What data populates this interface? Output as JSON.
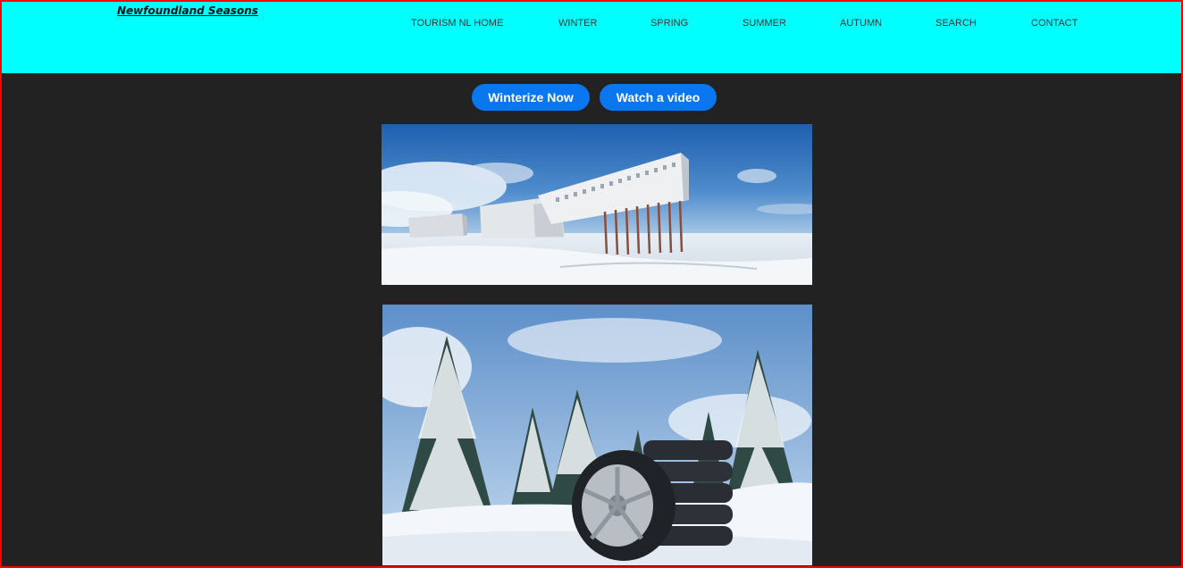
{
  "header": {
    "site_title": "Newfoundland Seasons",
    "nav": [
      "TOURISM NL HOME",
      "WINTER",
      "SPRING",
      "SUMMER",
      "AUTUMN",
      "SEARCH",
      "CONTACT"
    ]
  },
  "actions": {
    "primary_label": "Winterize Now",
    "secondary_label": "Watch a video"
  },
  "colors": {
    "header_bg": "#00ffff",
    "page_bg": "#222222",
    "button_bg": "#0a77f0",
    "frame_border": "#ff0000"
  },
  "images": [
    {
      "subject": "winter-hotel-on-stilts-photo"
    },
    {
      "subject": "winter-tires-in-snowy-forest-photo"
    }
  ]
}
